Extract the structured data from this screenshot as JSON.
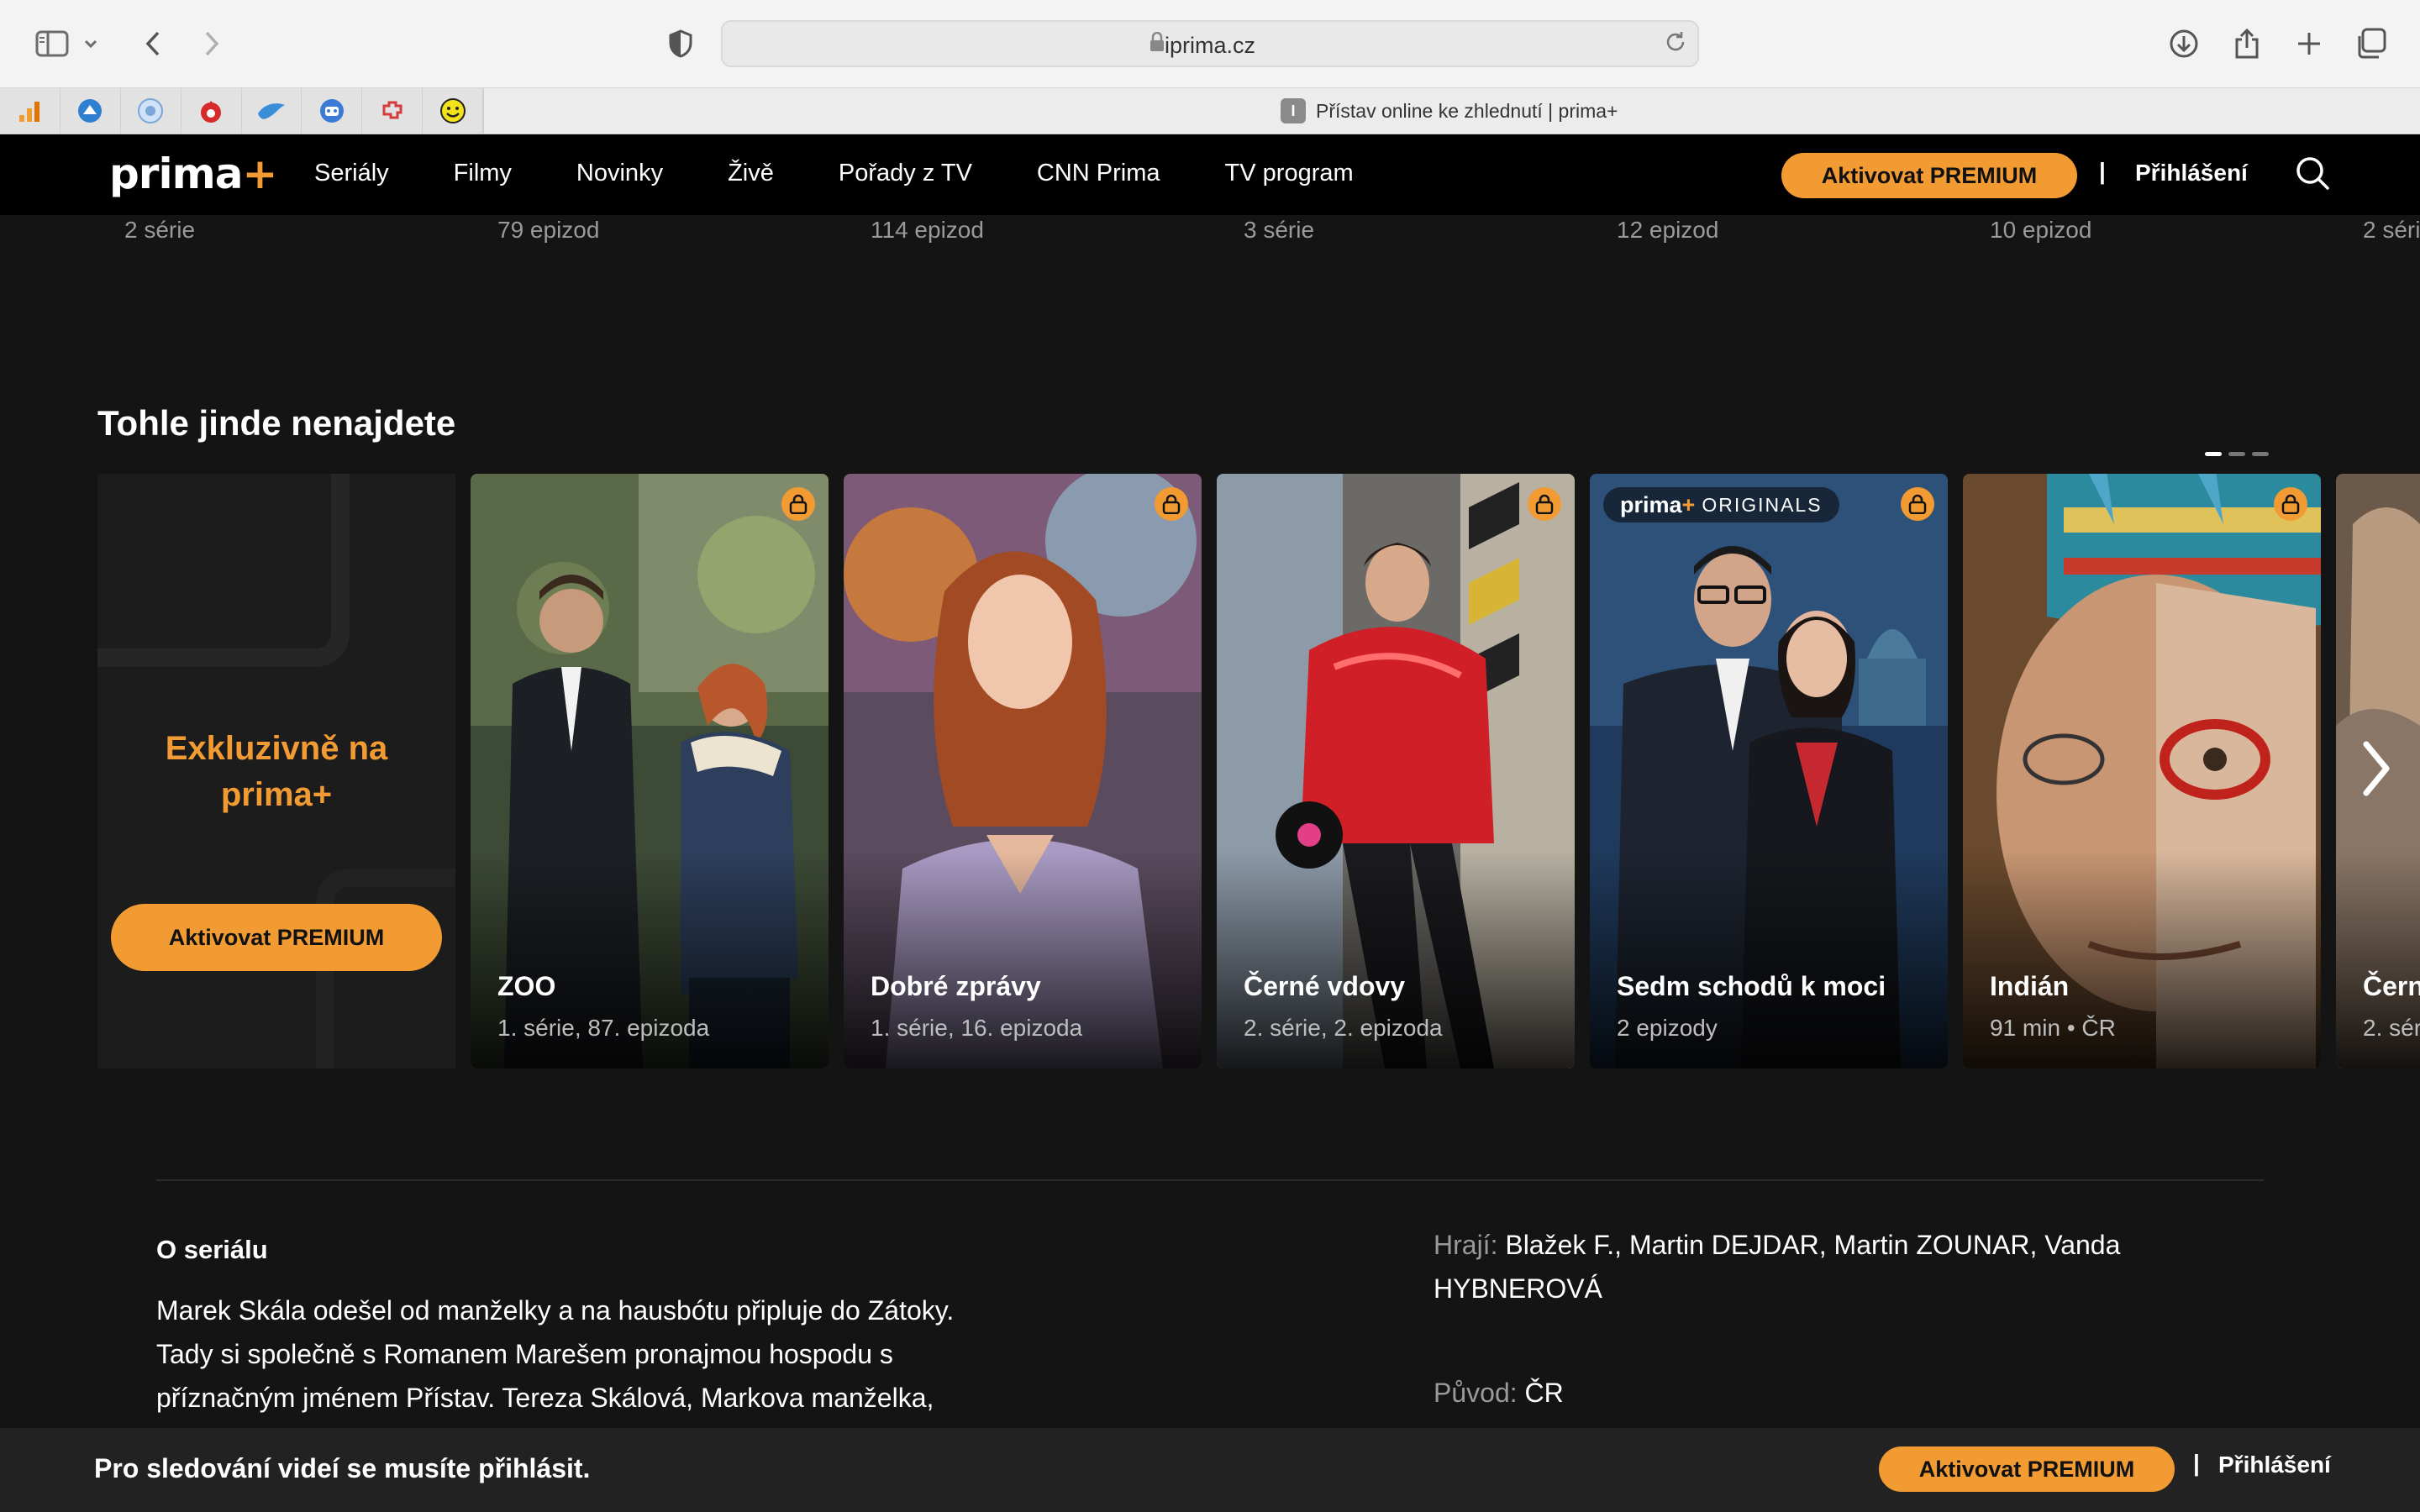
{
  "browser": {
    "url": "iprima.cz",
    "tab_title": "Přístav online ke zhlednutí | prima+",
    "tab_favicon": "I",
    "pinned_tabs": [
      "analytics-icon",
      "blue-circle-icon",
      "gear-badge-icon",
      "red-flame-icon",
      "bird-icon",
      "robot-icon",
      "puzzle-icon",
      "smiley-icon"
    ]
  },
  "header": {
    "logo_text": "prima",
    "logo_plus": "+",
    "nav": [
      "Seriály",
      "Filmy",
      "Novinky",
      "Živě",
      "Pořady z TV",
      "CNN Prima",
      "TV program"
    ],
    "premium_button": "Aktivovat PREMIUM",
    "separator": "|",
    "login": "Přihlášení"
  },
  "episode_counts": [
    "2 série",
    "79 epizod",
    "114 epizod",
    "3 série",
    "12 epizod",
    "10 epizod",
    "2 séri"
  ],
  "section": {
    "title": "Tohle jinde nenajdete",
    "promo": {
      "line1": "Exkluzivně na",
      "line2": "prima+",
      "button": "Aktivovat PREMIUM"
    },
    "cards": [
      {
        "title": "ZOO",
        "meta": "1. série, 87. epizoda"
      },
      {
        "title": "Dobré zprávy",
        "meta": "1. série, 16. epizoda"
      },
      {
        "title": "Černé vdovy",
        "meta": "2. série, 2. epizoda"
      },
      {
        "title": "Sedm schodů k moci",
        "meta": "2 epizody",
        "badge_logo": "prima",
        "badge_plus": "+",
        "badge_text": "ORIGINALS"
      },
      {
        "title": "Indián",
        "meta": "91 min • ČR"
      },
      {
        "title": "Čern",
        "meta": "2. sér"
      }
    ]
  },
  "about": {
    "heading": "O seriálu",
    "text": "Marek Skála odešel od manželky a na hausbótu připluje do Zátoky. Tady si společně s Romanem Marešem pronajmou hospodu s příznačným jménem Přístav. Tereza Skálová, Markova manželka,",
    "cast_label": "Hrají:",
    "cast": "Blažek F., Martin DEJDAR, Martin ZOUNAR, Vanda HYBNEROVÁ",
    "origin_label": "Původ:",
    "origin": "ČR"
  },
  "bottom_bar": {
    "message": "Pro sledování videí se musíte přihlásit.",
    "premium_button": "Aktivovat PREMIUM",
    "separator": "|",
    "login": "Přihlášení"
  },
  "colors": {
    "accent": "#f39b33",
    "background": "#141414",
    "header": "#000000"
  }
}
